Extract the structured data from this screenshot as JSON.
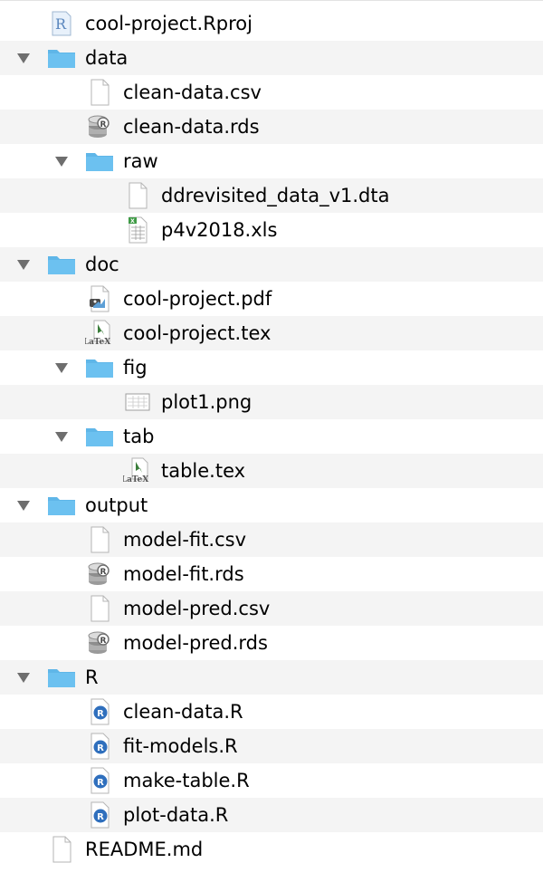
{
  "tree": {
    "items": [
      {
        "name": "cool-project.Rproj",
        "type": "rproj"
      },
      {
        "name": "data",
        "type": "folder"
      },
      {
        "name": "clean-data.csv",
        "type": "file"
      },
      {
        "name": "clean-data.rds",
        "type": "rds"
      },
      {
        "name": "raw",
        "type": "folder"
      },
      {
        "name": "ddrevisited_data_v1.dta",
        "type": "file"
      },
      {
        "name": "p4v2018.xls",
        "type": "xls"
      },
      {
        "name": "doc",
        "type": "folder"
      },
      {
        "name": "cool-project.pdf",
        "type": "pdf"
      },
      {
        "name": "cool-project.tex",
        "type": "tex"
      },
      {
        "name": "fig",
        "type": "folder"
      },
      {
        "name": "plot1.png",
        "type": "png"
      },
      {
        "name": "tab",
        "type": "folder"
      },
      {
        "name": "table.tex",
        "type": "tex"
      },
      {
        "name": "output",
        "type": "folder"
      },
      {
        "name": "model-fit.csv",
        "type": "file"
      },
      {
        "name": "model-fit.rds",
        "type": "rds"
      },
      {
        "name": "model-pred.csv",
        "type": "file"
      },
      {
        "name": "model-pred.rds",
        "type": "rds"
      },
      {
        "name": "R",
        "type": "folder"
      },
      {
        "name": "clean-data.R",
        "type": "rscript"
      },
      {
        "name": "fit-models.R",
        "type": "rscript"
      },
      {
        "name": "make-table.R",
        "type": "rscript"
      },
      {
        "name": "plot-data.R",
        "type": "rscript"
      },
      {
        "name": "README.md",
        "type": "file"
      }
    ]
  },
  "icon_text": {
    "rproj": "R",
    "rscript": "R",
    "tex": "LaTeX",
    "xls": "X"
  },
  "colors": {
    "folder": "#6cc1f0",
    "folder_tab": "#5fb6e8",
    "row_alt": "#f4f4f4",
    "disclosure": "#6e6e6e",
    "r_badge": "#2f6fbd"
  }
}
